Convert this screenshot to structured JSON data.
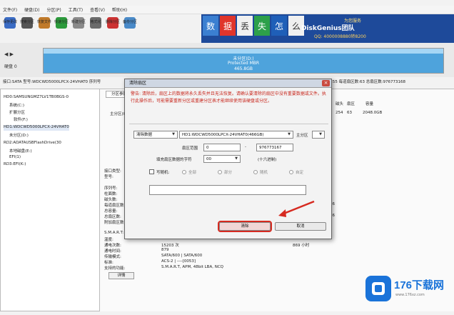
{
  "menu": [
    "文件(F)",
    "硬盘(D)",
    "分区(P)",
    "工具(T)",
    "查看(V)",
    "帮助(H)"
  ],
  "toolbar": [
    {
      "label": "保存更改",
      "icon": "save-icon",
      "color": "#3b6cc4"
    },
    {
      "label": "搜索分区",
      "icon": "search-icon",
      "color": "#555555"
    },
    {
      "label": "恢复文件",
      "icon": "restore-icon",
      "color": "#c07a2a"
    },
    {
      "label": "快速分区",
      "icon": "quick-partition-icon",
      "color": "#2c9a3c"
    },
    {
      "label": "新建分区",
      "icon": "new-partition-icon",
      "color": "#8a8a8a"
    },
    {
      "label": "格式化",
      "icon": "format-icon",
      "color": "#6b6b6b"
    },
    {
      "label": "删除分区",
      "icon": "delete-partition-icon",
      "color": "#cc3333"
    },
    {
      "label": "备份分区",
      "icon": "backup-partition-icon",
      "color": "#4a8ac8"
    }
  ],
  "ad": {
    "tiles": [
      "数",
      "据",
      "丢",
      "失",
      "怎",
      "么",
      "办"
    ],
    "brand": "DiskGenius团队",
    "sub": "为您服务",
    "qq": "QQ: 4000008880转8200"
  },
  "disk": {
    "line1": "未分区(D:)",
    "line2": "Protected MBR",
    "line3": "465.8GB",
    "nav_label": "◀ ▶",
    "side_label": "硬盘 0",
    "fill": 1.0
  },
  "infoline": {
    "left": "接口:SATA  型号:WDCWD5000LPCX-24VHAT0  序列号",
    "right": "磁头数:255  每道扇区数:63  总扇区数:976773168"
  },
  "tree": [
    "HD0:SAMSUNGMZ7LV1TB0BGS-0",
    "  系统(C:)",
    "  扩展分区",
    "    软件(F:)",
    "HD1:WDCWD5000LPCX-24VHAT0",
    "  未分区(D:)",
    "RD2:ADATAUSBFlashDrive(30",
    "  本地磁盘(E:)",
    "  EFI(1)",
    "RD3:EFI(K:)"
  ],
  "panel": {
    "tab": "分区参数",
    "col_headers": [
      "卷标",
      "序号(状态)",
      "文件系统",
      "标识",
      "起始柱面",
      "磁头",
      "扇区",
      "终止柱面",
      "磁头",
      "扇区",
      "容量"
    ],
    "row": [
      "主分区(0)",
      "",
      "",
      "",
      "",
      "",
      "",
      "",
      "254",
      "63",
      "2048.0GB"
    ],
    "fields": [
      "接口类型:",
      "型号:",
      "",
      "序列号:",
      "柱面数:",
      "磁头数:",
      "每道扇区数:",
      "总容量:",
      "总扇区数:",
      "附加扇区数:",
      "",
      "S.M.A.R.T:",
      "温度:",
      "通电次数:",
      "通电时间:",
      "传输模式:",
      "标准:",
      "支持的功能:"
    ],
    "fvals": [
      "",
      "",
      "",
      "",
      "",
      "",
      "",
      "",
      "",
      "",
      "",
      "",
      "",
      "15203 次",
      "879",
      "SATA/600 | SATA/600",
      "ACS-2 | ----[0053]",
      "S.M.A.R.T, APM, 48bit LBA, NCQ"
    ],
    "fval2": [
      "",
      "",
      "",
      "",
      "",
      "",
      "",
      "",
      "",
      "",
      "",
      "",
      "",
      "通电时间:",
      "",
      "",
      "",
      ""
    ],
    "fval3": [
      "",
      "",
      "",
      "",
      "",
      "",
      "",
      "",
      "",
      "",
      "",
      "",
      "",
      "869 小时",
      "",
      "",
      "",
      ""
    ],
    "rnums": [
      "",
      "",
      "",
      "",
      "",
      "",
      "",
      "",
      "",
      "",
      "",
      "",
      "",
      "",
      "",
      "",
      "",
      ""
    ],
    "right_col": [
      "",
      "",
      "",
      "",
      "",
      "",
      "",
      "",
      "",
      "",
      "",
      "",
      "",
      "",
      "",
      "",
      "",
      ""
    ],
    "detail_button": "详情",
    "side_numbers": [
      "16",
      "1",
      "16"
    ]
  },
  "dialog": {
    "title": "清除扇区",
    "close": "×",
    "warning": "警告: 清除后，扇区上的数据将永久丢失并且无法恢复。请确认要清除的扇区中没有重要数据或文件。执行此操作后，可能需要重新分区或重建分区表才能继续使用该硬盘或分区。",
    "fill_mode": "清除数据",
    "disk_select": "HD1:WDCWD5000LPCX-24VHAT0(466GB)",
    "target_label": "主分区",
    "range_label": "扇区范围",
    "range_from": "0",
    "range_sep": "-",
    "range_to": "976773167",
    "fill_char_label": "填充扇区数据的字符",
    "fill_char": "00",
    "hex_label": "(十六进制)",
    "cycle_label": "写随机:",
    "radios": [
      "全部",
      "部分",
      "随机",
      "自定"
    ],
    "message": "",
    "ok_button": "清除",
    "cancel_button": "取消"
  },
  "watermark": {
    "name": "176下载网",
    "url": "www.176xz.com"
  },
  "colors": {
    "disk_fill": "#4ea3dc",
    "warning_text": "#c8281e",
    "highlight_outline": "#d62a20",
    "brand_blue": "#1a73d9"
  }
}
